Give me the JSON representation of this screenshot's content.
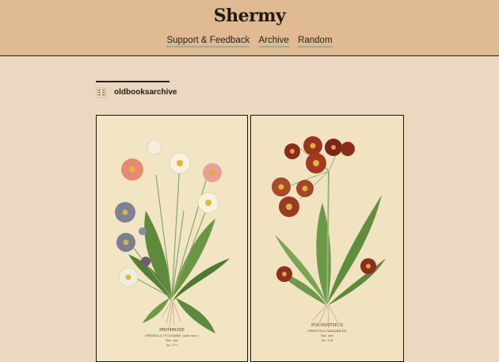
{
  "site": {
    "title": "Shermy"
  },
  "nav": {
    "items": [
      "Support & Feedback",
      "Archive",
      "Random"
    ]
  },
  "post": {
    "username": "oldbooksarchive",
    "plates": [
      {
        "caption": "PRIMROSE",
        "subcaption": "(PRIMULA VULGARIS, and vars.)",
        "note1": "Nat. size",
        "note2": "No. 177"
      },
      {
        "caption": "POLYANTHUS",
        "subcaption": "(PRIMULA VARIABILIS)",
        "note1": "Nat. size",
        "note2": "No. 178"
      }
    ]
  },
  "colors": {
    "header_bg": "#dfba93",
    "page_bg": "#ecd8c0",
    "nav_underline": "#9bb08e",
    "plate_bg": "#f3e7c6"
  }
}
